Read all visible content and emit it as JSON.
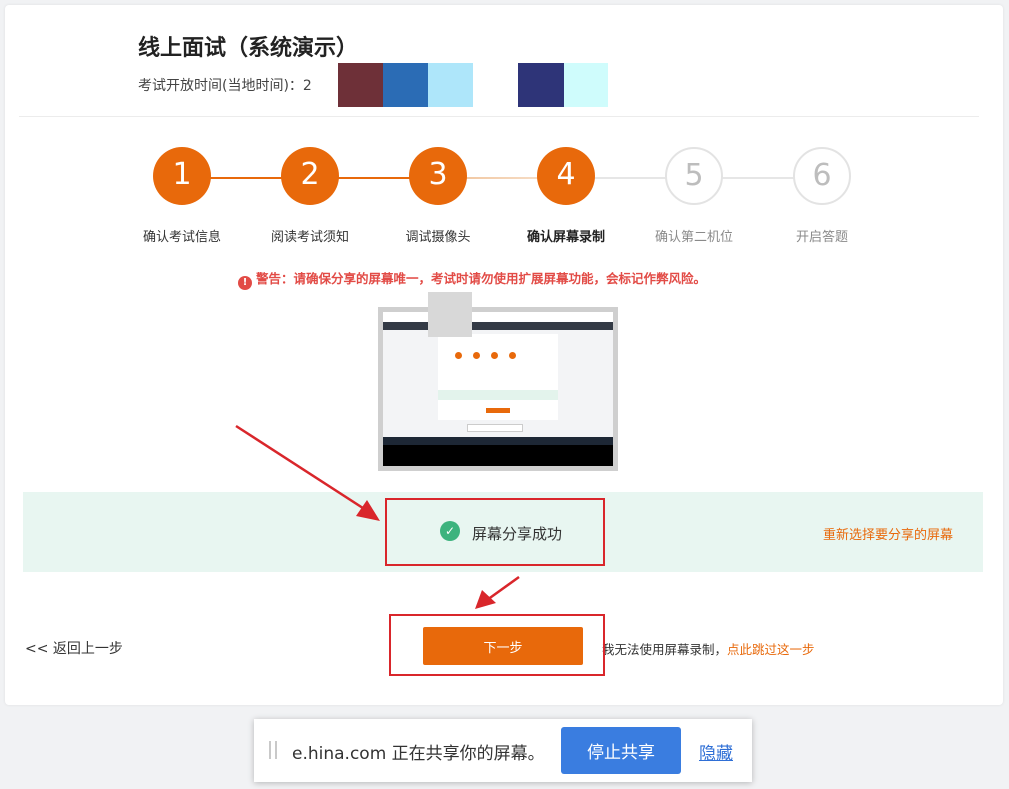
{
  "header": {
    "title": "线上面试（系统演示）",
    "open_time_label": "考试开放时间(当地时间)：2"
  },
  "redacted_blocks": [
    "#6e3038",
    "#2b6cb5",
    "#aee6fa",
    "#ffffff",
    "#2e3478",
    "#cffcfc"
  ],
  "steps": [
    {
      "number": "1",
      "label": "确认考试信息",
      "state": "done"
    },
    {
      "number": "2",
      "label": "阅读考试须知",
      "state": "done"
    },
    {
      "number": "3",
      "label": "调试摄像头",
      "state": "done"
    },
    {
      "number": "4",
      "label": "确认屏幕录制",
      "state": "active"
    },
    {
      "number": "5",
      "label": "确认第二机位",
      "state": "pending"
    },
    {
      "number": "6",
      "label": "开启答题",
      "state": "pending"
    }
  ],
  "warning": {
    "icon": "exclamation-icon",
    "text": "警告：请确保分享的屏幕唯一，考试时请勿使用扩展屏幕功能，会标记作弊风险。"
  },
  "status": {
    "icon": "check-circle-icon",
    "success_text": "屏幕分享成功",
    "reselect_link": "重新选择要分享的屏幕"
  },
  "footer": {
    "back_link": "<< 返回上一步",
    "next_button": "下一步",
    "skip_text": "我无法使用屏幕录制，",
    "skip_link": "点此跳过这一步"
  },
  "share_bar": {
    "message": "e.hina.com 正在共享你的屏幕。",
    "stop_button": "停止共享",
    "hide_link": "隐藏"
  },
  "colors": {
    "accent": "#e8690b",
    "success": "#3db37e",
    "warning": "#e24b46",
    "annotation": "#d9262b",
    "share_button": "#3a7de0"
  }
}
